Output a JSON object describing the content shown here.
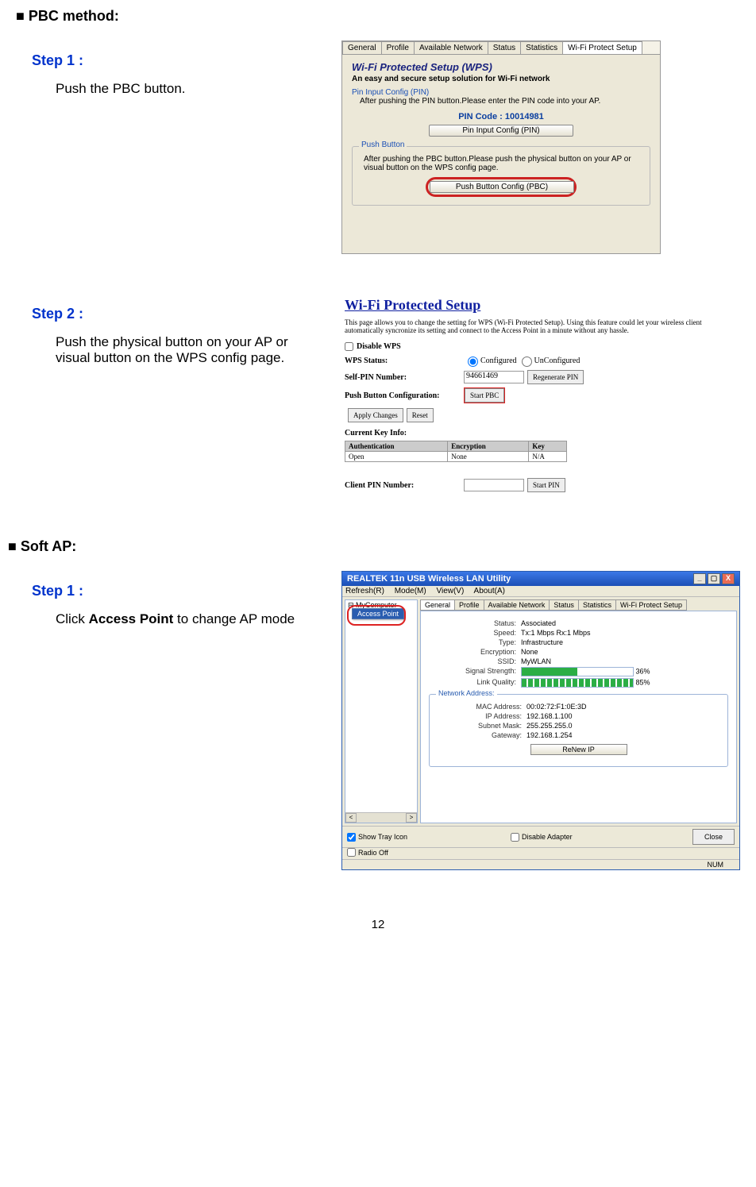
{
  "page_number": "12",
  "section1": {
    "title": "■ PBC method:",
    "step1_title": "Step 1 :",
    "step1_body": "Push the PBC button.",
    "step2_title": "Step 2 :",
    "step2_body": "Push the physical button on your AP or visual button on the WPS config page."
  },
  "section2": {
    "title": "■ Soft AP:",
    "step1_title": "Step 1 :",
    "step1_body_prefix": "Click ",
    "step1_body_bold": "Access Point",
    "step1_body_suffix": " to change AP mode"
  },
  "wps_dialog": {
    "tabs": [
      "General",
      "Profile",
      "Available Network",
      "Status",
      "Statistics",
      "Wi-Fi Protect Setup"
    ],
    "active_tab_index": 5,
    "heading": "Wi-Fi Protected Setup (WPS)",
    "subheading": "An easy and secure setup solution for Wi-Fi network",
    "pin_group_label": "Pin Input Config (PIN)",
    "pin_instr": "After pushing the PIN button.Please enter the PIN code into your AP.",
    "pin_code_label": "PIN Code :  10014981",
    "pin_btn": "Pin Input Config (PIN)",
    "push_group_label": "Push Button",
    "push_instr": "After pushing the PBC button.Please push the physical button on your AP or visual button on the WPS config page.",
    "pbc_btn": "Push Button Config (PBC)"
  },
  "ap_page": {
    "title": "Wi-Fi Protected Setup",
    "desc": "This page allows you to change the setting for WPS (Wi-Fi Protected Setup). Using this feature could let your wireless client automatically syncronize its setting and connect to the Access Point in a minute without any hassle.",
    "disable_wps": "Disable WPS",
    "wps_status_label": "WPS Status:",
    "wps_status_opt1": "Configured",
    "wps_status_opt2": "UnConfigured",
    "self_pin_label": "Self-PIN Number:",
    "self_pin_value": "94661469",
    "regen_btn": "Regenerate PIN",
    "pbc_label": "Push Button Configuration:",
    "start_pbc_btn": "Start PBC",
    "apply_btn": "Apply Changes",
    "reset_btn": "Reset",
    "key_info_label": "Current Key Info:",
    "key_headers": [
      "Authentication",
      "Encryption",
      "Key"
    ],
    "key_row": [
      "Open",
      "None",
      "N/A"
    ],
    "client_pin_label": "Client PIN Number:",
    "start_pin_btn": "Start PIN"
  },
  "util": {
    "title": "REALTEK 11n USB Wireless LAN Utility",
    "menu": [
      "Refresh(R)",
      "Mode(M)",
      "View(V)",
      "About(A)"
    ],
    "tree_root": "MyComputer",
    "ap_menu_item": "Access Point",
    "tabs": [
      "General",
      "Profile",
      "Available Network",
      "Status",
      "Statistics",
      "Wi-Fi Protect Setup"
    ],
    "active_tab_index": 0,
    "stats": {
      "status_label": "Status:",
      "status": "Associated",
      "speed_label": "Speed:",
      "speed": "Tx:1 Mbps Rx:1 Mbps",
      "type_label": "Type:",
      "type": "Infrastructure",
      "enc_label": "Encryption:",
      "enc": "None",
      "ssid_label": "SSID:",
      "ssid": "MyWLAN",
      "sig_label": "Signal Strength:",
      "sig_pct": "36%",
      "link_label": "Link Quality:",
      "link_pct": "85%"
    },
    "net": {
      "legend": "Network Address:",
      "mac_label": "MAC Address:",
      "mac": "00:02:72:F1:0E:3D",
      "ip_label": "IP Address:",
      "ip": "192.168.1.100",
      "mask_label": "Subnet Mask:",
      "mask": "255.255.255.0",
      "gw_label": "Gateway:",
      "gw": "192.168.1.254",
      "renew_btn": "ReNew IP"
    },
    "footer": {
      "show_tray": "Show Tray Icon",
      "radio_off": "Radio Off",
      "disable_adapter": "Disable Adapter",
      "close": "Close"
    },
    "status_bar": "NUM"
  }
}
